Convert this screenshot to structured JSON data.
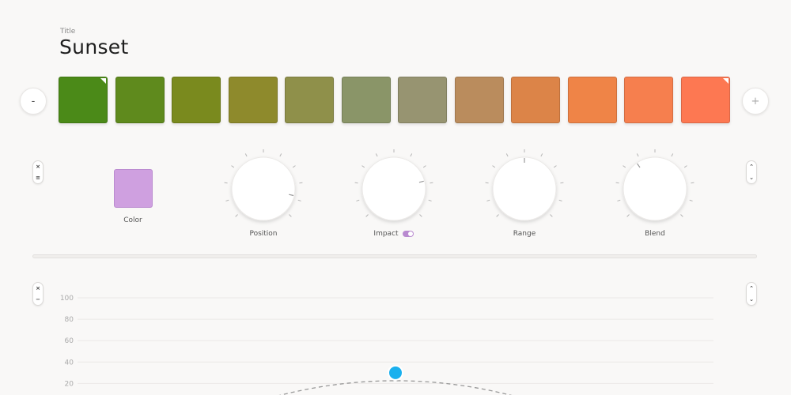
{
  "header": {
    "title_label": "Title",
    "title_value": "Sunset"
  },
  "palette": {
    "minus_label": "-",
    "plus_label": "+",
    "swatches": [
      {
        "color": "#4b8a18",
        "marked": true
      },
      {
        "color": "#5f8a1d",
        "marked": false
      },
      {
        "color": "#7a8a1e",
        "marked": false
      },
      {
        "color": "#8e8a2c",
        "marked": false
      },
      {
        "color": "#8f904a",
        "marked": false
      },
      {
        "color": "#8a9568",
        "marked": false
      },
      {
        "color": "#979471",
        "marked": false
      },
      {
        "color": "#ba8c5d",
        "marked": false
      },
      {
        "color": "#dc8448",
        "marked": false
      },
      {
        "color": "#ef8447",
        "marked": false
      },
      {
        "color": "#f67f4e",
        "marked": false
      },
      {
        "color": "#fd7852",
        "marked": true
      }
    ]
  },
  "controls": {
    "color_label": "Color",
    "color_value": "#cfa0e0",
    "knobs": [
      {
        "label": "Position",
        "value": 0.88
      },
      {
        "label": "Impact",
        "value": 0.78
      },
      {
        "label": "Range",
        "value": 0.5
      },
      {
        "label": "Blend",
        "value": 0.37
      }
    ],
    "impact_toggle_on": true
  },
  "side_controls": {
    "close_glyph": "×",
    "handle_glyph": "≡",
    "minus_glyph": "−",
    "up_glyph": "⌃",
    "down_glyph": "⌄"
  },
  "graph": {
    "y_ticks": [
      "100",
      "80",
      "60",
      "40",
      "20"
    ],
    "curve_color": "#999999",
    "point_color": "#1ab0ee",
    "point": {
      "x": 0.5,
      "y": 30
    }
  }
}
